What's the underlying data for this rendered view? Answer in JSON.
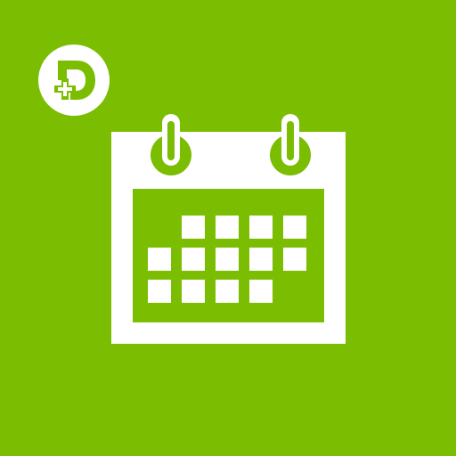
{
  "app": {
    "icon_name": "calendar-icon",
    "logo_name": "brand-logo-icon"
  },
  "colors": {
    "background": "#7bbd00",
    "foreground": "#ffffff"
  },
  "calendar": {
    "day_cells_shown": [
      [
        false,
        true,
        true,
        true,
        true
      ],
      [
        true,
        true,
        true,
        true,
        true
      ],
      [
        true,
        true,
        true,
        true,
        false
      ]
    ]
  }
}
